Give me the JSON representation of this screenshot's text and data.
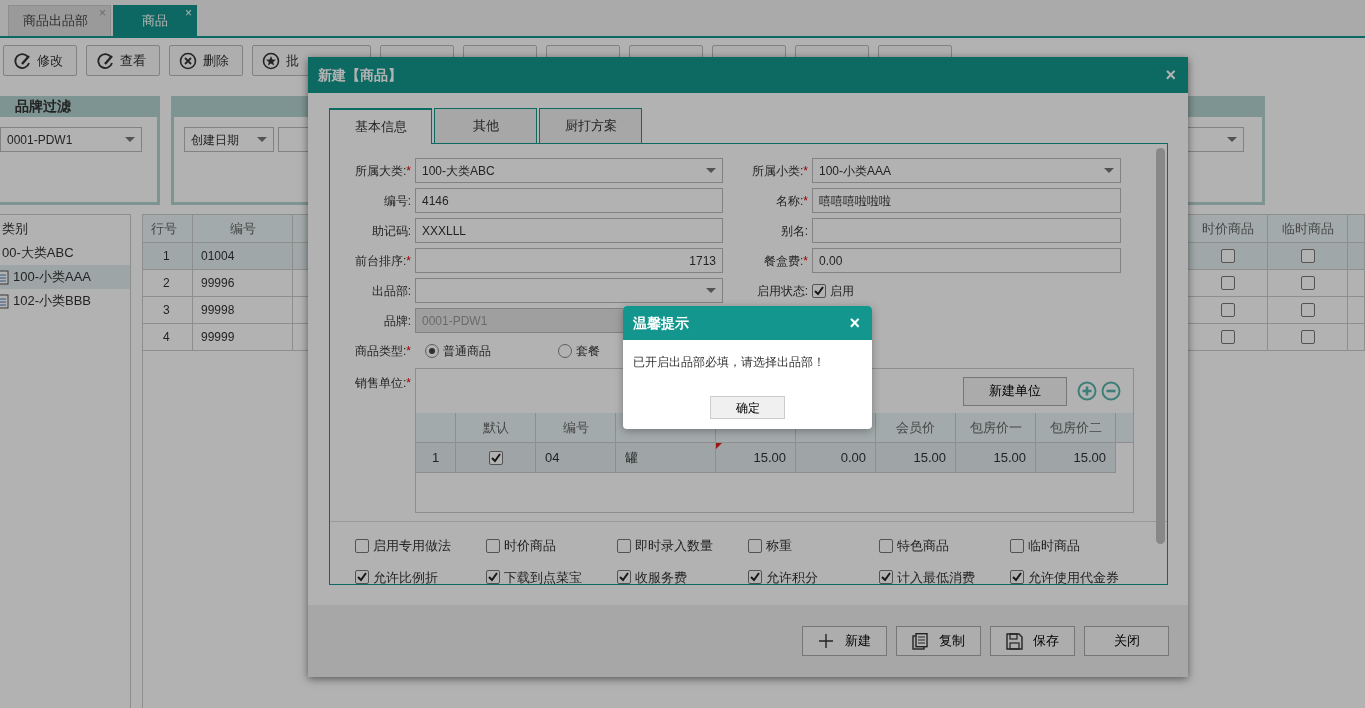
{
  "app_tabs": [
    {
      "label": "商品出品部",
      "selected": false,
      "close": "×"
    },
    {
      "label": "商品",
      "selected": true,
      "close": "×"
    }
  ],
  "toolbar": [
    {
      "kind": "edit",
      "label": "修改"
    },
    {
      "kind": "view",
      "label": "查看"
    },
    {
      "kind": "delete",
      "label": "删除"
    },
    {
      "kind": "upload",
      "label": "批"
    },
    {
      "kind": "covered"
    },
    {
      "kind": "covered"
    },
    {
      "kind": "covered"
    },
    {
      "kind": "covered"
    },
    {
      "kind": "covered"
    },
    {
      "kind": "covered"
    },
    {
      "kind": "covered"
    }
  ],
  "brand_filter": {
    "title": "品牌过滤",
    "value": "0001-PDW1"
  },
  "date_filter": {
    "value": "创建日期"
  },
  "category_tree": {
    "title": "类别",
    "items": [
      {
        "label": "00-大类ABC",
        "selected": false,
        "children": [
          {
            "label": "100-小类AAA",
            "selected": true
          },
          {
            "label": "102-小类BBB",
            "selected": false
          }
        ]
      }
    ]
  },
  "grid": {
    "columns": [
      {
        "label": "行号"
      },
      {
        "label": "编号"
      },
      {
        "label": "时价商品"
      },
      {
        "label": "临时商品"
      }
    ],
    "rows": [
      {
        "no": "1",
        "code": "01004",
        "selected": true,
        "time_price": false,
        "temporary": false
      },
      {
        "no": "2",
        "code": "99996",
        "selected": false,
        "time_price": false,
        "temporary": false
      },
      {
        "no": "3",
        "code": "99998",
        "selected": false,
        "time_price": false,
        "temporary": false
      },
      {
        "no": "4",
        "code": "99999",
        "selected": false,
        "time_price": false,
        "temporary": false
      }
    ]
  },
  "dialog": {
    "title": "新建【商品】",
    "close": "×",
    "tabs": [
      {
        "label": "基本信息",
        "selected": true
      },
      {
        "label": "其他",
        "selected": false
      },
      {
        "label": "厨打方案",
        "selected": false
      }
    ],
    "form_rows": [
      [
        {
          "kind": "select",
          "label": "所属大类:",
          "required_mark": "*",
          "value": "100-大类ABC",
          "disabled": false
        },
        {
          "kind": "select",
          "label": "所属小类:",
          "required_mark": "*",
          "value": "100-小类AAA",
          "disabled": false
        }
      ],
      [
        {
          "kind": "text",
          "label": "编号:",
          "value": "4146",
          "disabled": false
        },
        {
          "kind": "text",
          "label": "名称:",
          "required_mark": "*",
          "value": "嘻嘻嘻啦啦啦",
          "disabled": false
        }
      ],
      [
        {
          "kind": "text",
          "label": "助记码:",
          "value": "XXXLLL",
          "disabled": false
        },
        {
          "kind": "text",
          "label": "别名:",
          "disabled": false
        }
      ],
      [
        {
          "kind": "number",
          "label": "前台排序:",
          "required_mark": "*",
          "value": "1713",
          "disabled": false
        },
        {
          "kind": "text",
          "label": "餐盒费:",
          "required_mark": "*",
          "value": "0.00",
          "disabled": false
        }
      ],
      [
        {
          "kind": "select",
          "label": "出品部:",
          "disabled": false
        },
        {
          "kind": "checkbox",
          "label": "启用状态:",
          "option": "启用",
          "checked": true
        }
      ],
      [
        {
          "kind": "text",
          "label": "品牌:",
          "value": "0001-PDW1",
          "disabled": true
        }
      ],
      [
        {
          "kind": "radio",
          "label": "商品类型:",
          "required_mark": "*",
          "options": [
            {
              "label": "普通商品",
              "selected": true
            },
            {
              "label": "套餐",
              "selected": false
            }
          ]
        }
      ]
    ],
    "sales_units": {
      "label": "销售单位:",
      "required_mark": "*",
      "new_button": "新建单位",
      "columns": [
        {
          "kind": "blank"
        },
        {
          "kind": "text",
          "label": "默认"
        },
        {
          "kind": "text",
          "label": "编号"
        },
        {
          "kind": "blank"
        },
        {
          "kind": "blank"
        },
        {
          "kind": "blank"
        },
        {
          "kind": "text",
          "label": "会员价"
        },
        {
          "kind": "text",
          "label": "包房价一"
        },
        {
          "kind": "text",
          "label": "包房价二"
        }
      ],
      "rows": [
        {
          "no": "1",
          "default": true,
          "code": "04",
          "name": "罐",
          "ref_price": "15.00",
          "ref_price_modified": true,
          "ratio": "0.00",
          "member_price": "15.00",
          "room_price_1": "15.00",
          "room_price_2": "15.00"
        }
      ]
    },
    "options": [
      {
        "label": "启用专用做法",
        "checked": false
      },
      {
        "label": "时价商品",
        "checked": false
      },
      {
        "label": "即时录入数量",
        "checked": false
      },
      {
        "label": "称重",
        "checked": false
      },
      {
        "label": "特色商品",
        "checked": false
      },
      {
        "label": "临时商品",
        "checked": false
      },
      {
        "label": "允许比例折",
        "checked": true
      },
      {
        "label": "下载到点菜宝",
        "checked": true
      },
      {
        "label": "收服务费",
        "checked": true
      },
      {
        "label": "允许积分",
        "checked": true
      },
      {
        "label": "计入最低消费",
        "checked": true
      },
      {
        "label": "允许使用代金券",
        "checked": true
      }
    ],
    "footer_buttons": [
      {
        "kind": "new",
        "label": "新建"
      },
      {
        "kind": "copy",
        "label": "复制"
      },
      {
        "kind": "save",
        "label": "保存"
      },
      {
        "kind": "plain",
        "label": "关闭"
      }
    ]
  },
  "alert": {
    "title": "温馨提示",
    "close": "×",
    "message": "已开启出品部必填，请选择出品部！",
    "button": "确定"
  }
}
